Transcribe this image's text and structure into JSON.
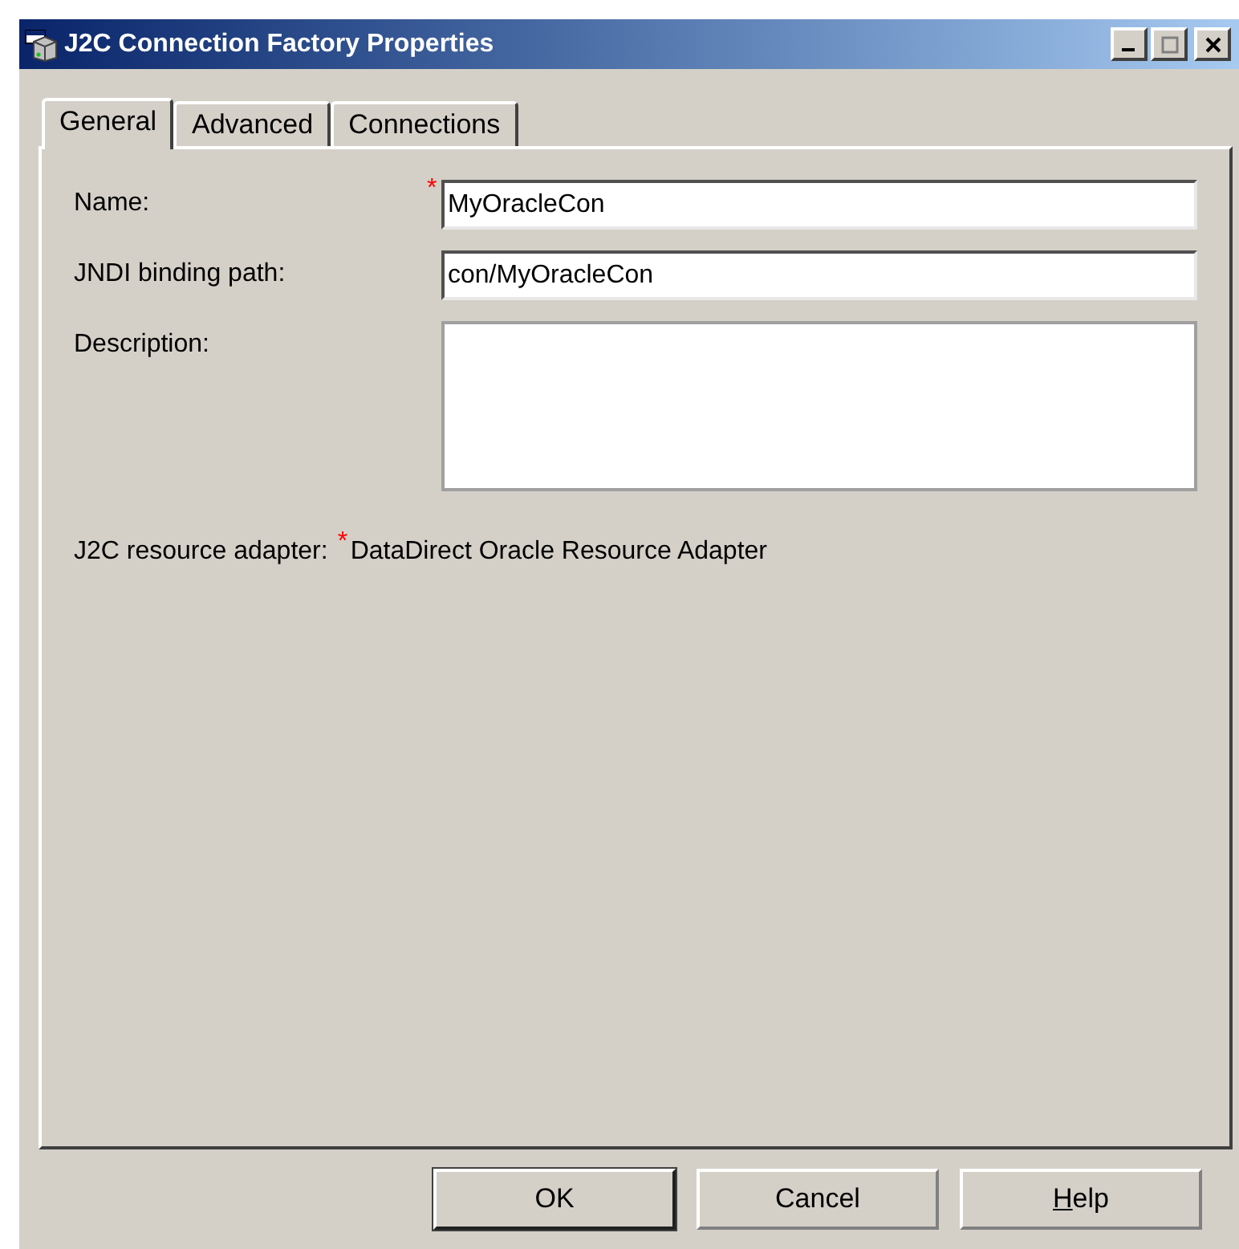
{
  "window": {
    "title": "J2C Connection Factory Properties"
  },
  "tabs": [
    {
      "label": "General",
      "selected": true
    },
    {
      "label": "Advanced",
      "selected": false
    },
    {
      "label": "Connections",
      "selected": false
    }
  ],
  "fields": [
    {
      "kind": "input",
      "label": "Name:",
      "required_mark": "*",
      "value": "MyOracleCon"
    },
    {
      "kind": "input",
      "label": "JNDI binding path:",
      "value": "con/MyOracleCon"
    },
    {
      "kind": "textarea",
      "label": "Description:"
    },
    {
      "kind": "static",
      "label": "J2C resource adapter:",
      "required_mark": "*",
      "value": "DataDirect Oracle Resource Adapter"
    }
  ],
  "buttons": [
    {
      "label": "OK",
      "default": true
    },
    {
      "label": "Cancel",
      "default": false
    },
    {
      "mnemonic": "H",
      "label": "elp",
      "default": false
    }
  ]
}
